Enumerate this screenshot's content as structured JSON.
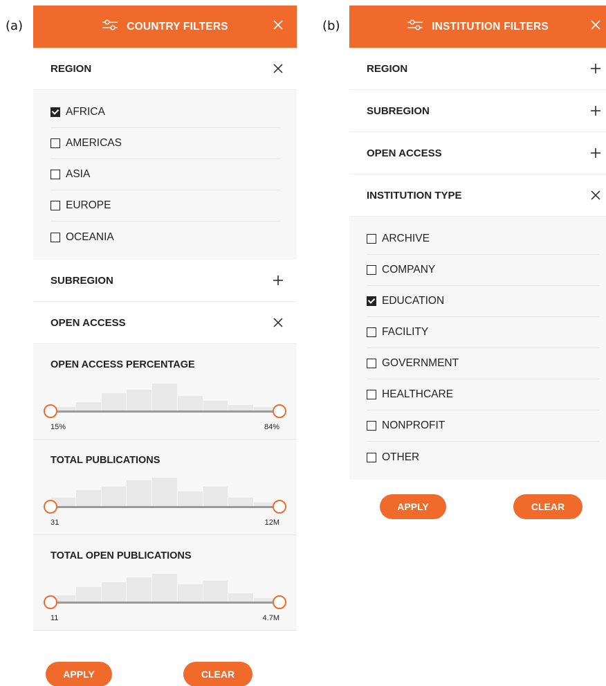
{
  "panel_a": {
    "letter": "(a)",
    "title": "COUNTRY FILTERS",
    "region": {
      "title": "REGION",
      "items": [
        {
          "label": "AFRICA",
          "checked": true
        },
        {
          "label": "AMERICAS",
          "checked": false
        },
        {
          "label": "ASIA",
          "checked": false
        },
        {
          "label": "EUROPE",
          "checked": false
        },
        {
          "label": "OCEANIA",
          "checked": false
        }
      ]
    },
    "subregion": {
      "title": "SUBREGION"
    },
    "open_access": {
      "title": "OPEN ACCESS"
    },
    "ranges": [
      {
        "title": "OPEN ACCESS PERCENTAGE",
        "min_label": "15%",
        "max_label": "84%",
        "histogram": [
          0.1,
          0.25,
          0.55,
          0.65,
          0.85,
          0.45,
          0.3,
          0.18,
          0.1
        ]
      },
      {
        "title": "TOTAL PUBLICATIONS",
        "min_label": "31",
        "max_label": "12M",
        "histogram": [
          0.25,
          0.5,
          0.6,
          0.8,
          0.9,
          0.45,
          0.6,
          0.25,
          0.1
        ]
      },
      {
        "title": "TOTAL OPEN PUBLICATIONS",
        "min_label": "11",
        "max_label": "4.7M",
        "histogram": [
          0.2,
          0.45,
          0.6,
          0.75,
          0.88,
          0.55,
          0.65,
          0.25,
          0.1
        ]
      }
    ],
    "apply_label": "APPLY",
    "clear_label": "CLEAR"
  },
  "panel_b": {
    "letter": "(b)",
    "title": "INSTITUTION FILTERS",
    "region": {
      "title": "REGION"
    },
    "subregion": {
      "title": "SUBREGION"
    },
    "open_access": {
      "title": "OPEN ACCESS"
    },
    "institution_type": {
      "title": "INSTITUTION TYPE",
      "items": [
        {
          "label": "ARCHIVE",
          "checked": false
        },
        {
          "label": "COMPANY",
          "checked": false
        },
        {
          "label": "EDUCATION",
          "checked": true
        },
        {
          "label": "FACILITY",
          "checked": false
        },
        {
          "label": "GOVERNMENT",
          "checked": false
        },
        {
          "label": "HEALTHCARE",
          "checked": false
        },
        {
          "label": "NONPROFIT",
          "checked": false
        },
        {
          "label": "OTHER",
          "checked": false
        }
      ]
    },
    "apply_label": "APPLY",
    "clear_label": "CLEAR"
  },
  "icons": {
    "header": "filter-sliders-icon",
    "expand": "plus-icon",
    "collapse": "close-icon"
  },
  "colors": {
    "accent": "#f06a2b",
    "panel_gray": "#f7f7f7",
    "track": "#9a9a9a",
    "histogram": "#e8e8e8"
  }
}
